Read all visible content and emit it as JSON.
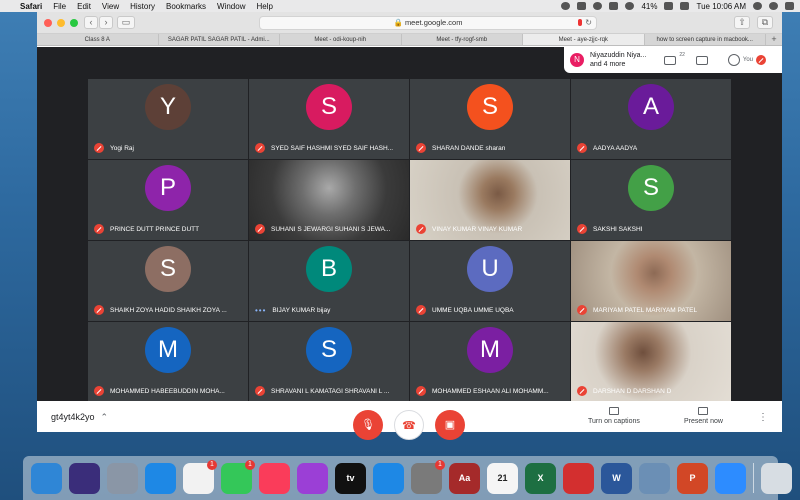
{
  "menubar": {
    "app": "Safari",
    "items": [
      "File",
      "Edit",
      "View",
      "History",
      "Bookmarks",
      "Window",
      "Help"
    ],
    "battery": "41%",
    "clock": "Tue 10:06 AM"
  },
  "browser": {
    "url": "meet.google.com",
    "tabs": [
      {
        "label": "Class 8 A",
        "active": false
      },
      {
        "label": "SAGAR PATIL SAGAR PATIL - Admi...",
        "active": false
      },
      {
        "label": "Meet - odi-koup-nih",
        "active": false
      },
      {
        "label": "Meet - tfy-rogf-smb",
        "active": false
      },
      {
        "label": "Meet - aye-zjjc-rqk",
        "active": true
      },
      {
        "label": "how to screen capture in macbook...",
        "active": false
      }
    ],
    "new_tab": "+"
  },
  "meet": {
    "presenter_popup": {
      "initial": "N",
      "line1": "Niyazuddin Niya...",
      "line2": "and 4 more"
    },
    "participant_count": "22",
    "you_label": "You",
    "tiles": [
      {
        "name": "Yogi Raj",
        "initial": "Y",
        "color": "#5d4037",
        "muted": true
      },
      {
        "name": "SYED SAIF HASHMI SYED SAIF HASH...",
        "initial": "S",
        "color": "#d81b60",
        "muted": true
      },
      {
        "name": "SHARAN DANDE sharan",
        "initial": "S",
        "color": "#f4511e",
        "muted": true
      },
      {
        "name": "AADYA AADYA",
        "initial": "A",
        "color": "#6a1b9a",
        "muted": true
      },
      {
        "name": "PRINCE DUTT PRINCE DUTT",
        "initial": "P",
        "color": "#8e24aa",
        "muted": true
      },
      {
        "name": "SUHANI S JEWARGI SUHANI S JEWA...",
        "video": "v1",
        "muted": true
      },
      {
        "name": "VINAY KUMAR VINAY KUMAR",
        "video": "v2",
        "muted": true
      },
      {
        "name": "SAKSHI SAKSHI",
        "initial": "S",
        "color": "#43a047",
        "muted": true
      },
      {
        "name": "SHAIKH ZOYA HADID SHAIKH ZOYA ...",
        "initial": "S",
        "color": "#8d6e63",
        "muted": true
      },
      {
        "name": "BIJAY KUMAR bijay",
        "initial": "B",
        "color": "#00897b",
        "muted": false
      },
      {
        "name": "UMME UQBA UMME UQBA",
        "initial": "U",
        "color": "#5c6bc0",
        "muted": true
      },
      {
        "name": "MARIYAM PATEL MARIYAM PATEL",
        "video": "v3",
        "muted": true
      },
      {
        "name": "MOHAMMED HABEEBUDDIN MOHA...",
        "initial": "M",
        "color": "#1565c0",
        "muted": true
      },
      {
        "name": "SHRAVANI L KAMATAGI SHRAVANI L ...",
        "initial": "S",
        "color": "#1565c0",
        "muted": true
      },
      {
        "name": "MOHAMMED ESHAAN ALI MOHAMM...",
        "initial": "M",
        "color": "#7b1fa2",
        "muted": true
      },
      {
        "name": "DARSHAN D DARSHAN D",
        "video": "v4",
        "muted": true
      }
    ],
    "bottom": {
      "meeting_code": "gt4yt4k2yo",
      "captions_label": "Turn on captions",
      "present_label": "Present now"
    }
  },
  "dock": {
    "items": [
      {
        "name": "finder-icon",
        "color": "#2f86d6"
      },
      {
        "name": "siri-icon",
        "color": "#3a2d7a"
      },
      {
        "name": "launchpad-icon",
        "color": "#8a96a6"
      },
      {
        "name": "safari-icon",
        "color": "#1e88e5"
      },
      {
        "name": "photos-icon",
        "color": "#f2f2f2",
        "badge": "1"
      },
      {
        "name": "facetime-icon",
        "color": "#34c759",
        "badge": "1"
      },
      {
        "name": "music-icon",
        "color": "#fa3c5a"
      },
      {
        "name": "podcasts-icon",
        "color": "#9b3fd6"
      },
      {
        "name": "tv-icon",
        "color": "#111111",
        "text": "tv"
      },
      {
        "name": "app-store-icon",
        "color": "#1e88e5"
      },
      {
        "name": "system-preferences-icon",
        "color": "#7a7a7a",
        "badge": "1"
      },
      {
        "name": "dictionary-icon",
        "color": "#a52a2a",
        "text": "Aa"
      },
      {
        "name": "calendar-icon",
        "color": "#f5f5f5",
        "text": "21"
      },
      {
        "name": "excel-icon",
        "color": "#1d6f42",
        "text": "X"
      },
      {
        "name": "acrobat-icon",
        "color": "#d32f2f"
      },
      {
        "name": "word-icon",
        "color": "#2b579a",
        "text": "W"
      },
      {
        "name": "preview-icon",
        "color": "#6b8fb5"
      },
      {
        "name": "powerpoint-icon",
        "color": "#d24726",
        "text": "P"
      },
      {
        "name": "zoom-icon",
        "color": "#2d8cff"
      },
      {
        "name": "trash-icon",
        "color": "#d7dde3"
      }
    ]
  }
}
